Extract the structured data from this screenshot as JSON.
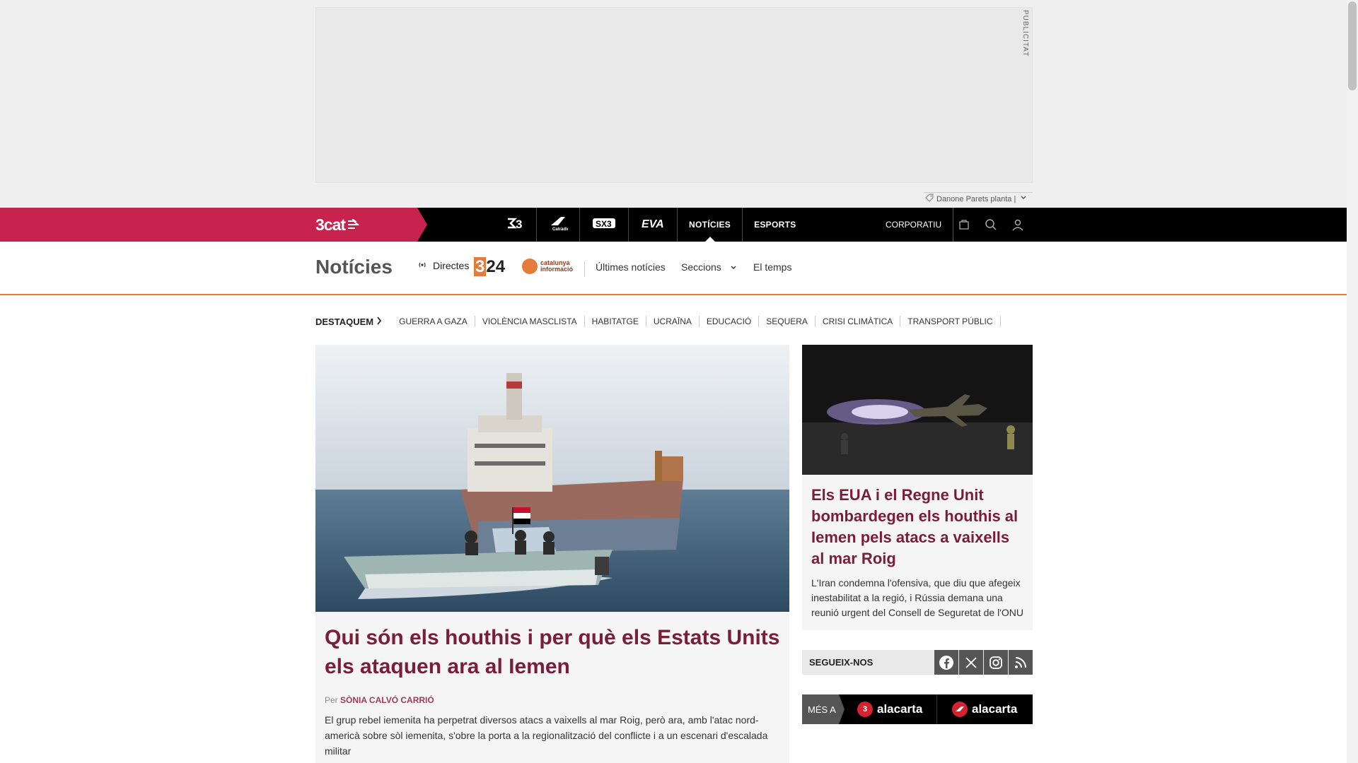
{
  "ad": {
    "publicitat": "PUBLICITAT",
    "info_text": "Danone Parets planta |"
  },
  "topnav": {
    "brand": "3cat",
    "channels": [
      {
        "label": ""
      },
      {
        "label": ""
      },
      {
        "label": ""
      },
      {
        "label": ""
      },
      {
        "label": "NOTÍCIES"
      },
      {
        "label": "ESPORTS"
      }
    ],
    "corporatiu": "CORPORATIU"
  },
  "section": {
    "title": "Notícies",
    "directes": "Directes",
    "logo_324": "24",
    "logo_324_prefix": "3",
    "cat_info_line1": "catalunya",
    "cat_info_line2": "informació",
    "ultimes": "Últimes notícies",
    "seccions": "Seccions",
    "el_temps": "El temps"
  },
  "destaquem": {
    "label": "DESTAQUEM",
    "tags": [
      "GUERRA A GAZA",
      "VIOLÈNCIA MASCLISTA",
      "HABITATGE",
      "UCRAÏNA",
      "EDUCACIÓ",
      "SEQUERA",
      "CRISI CLIMÀTICA",
      "TRANSPORT PÚBLIC"
    ]
  },
  "main_article": {
    "title": "Qui són els houthis i per què els Estats Units els ataquen ara al Iemen",
    "byline_prefix": "Per",
    "author": "Sònia Calvó Carrió",
    "lead": "El grup rebel iemenita ha perpetrat diversos atacs a vaixells al mar Roig, però ara, amb l'atac nord-americà sobre sòl iemenita, s'obre la porta a la regionalització del conflicte i a un escenari d'escalada militar"
  },
  "side_article": {
    "title": "Els EUA i el Regne Unit bombardegen els houthis al Iemen pels atacs a vaixells al mar Roig",
    "lead": "L'Iran condemna l'ofensiva, que diu que afegeix inestabilitat a la regió, i Rússia demana una reunió urgent del Consell de Seguretat de l'ONU"
  },
  "follow": {
    "label": "SEGUEIX-NOS"
  },
  "mesa": {
    "label": "MÉS A",
    "items": [
      {
        "badge": "3",
        "label": "alacarta"
      },
      {
        "badge": "",
        "label": "alacarta"
      }
    ]
  },
  "colors": {
    "brand": "#c8224e",
    "accent": "#e37b3b",
    "headline": "#7a1d3a"
  }
}
